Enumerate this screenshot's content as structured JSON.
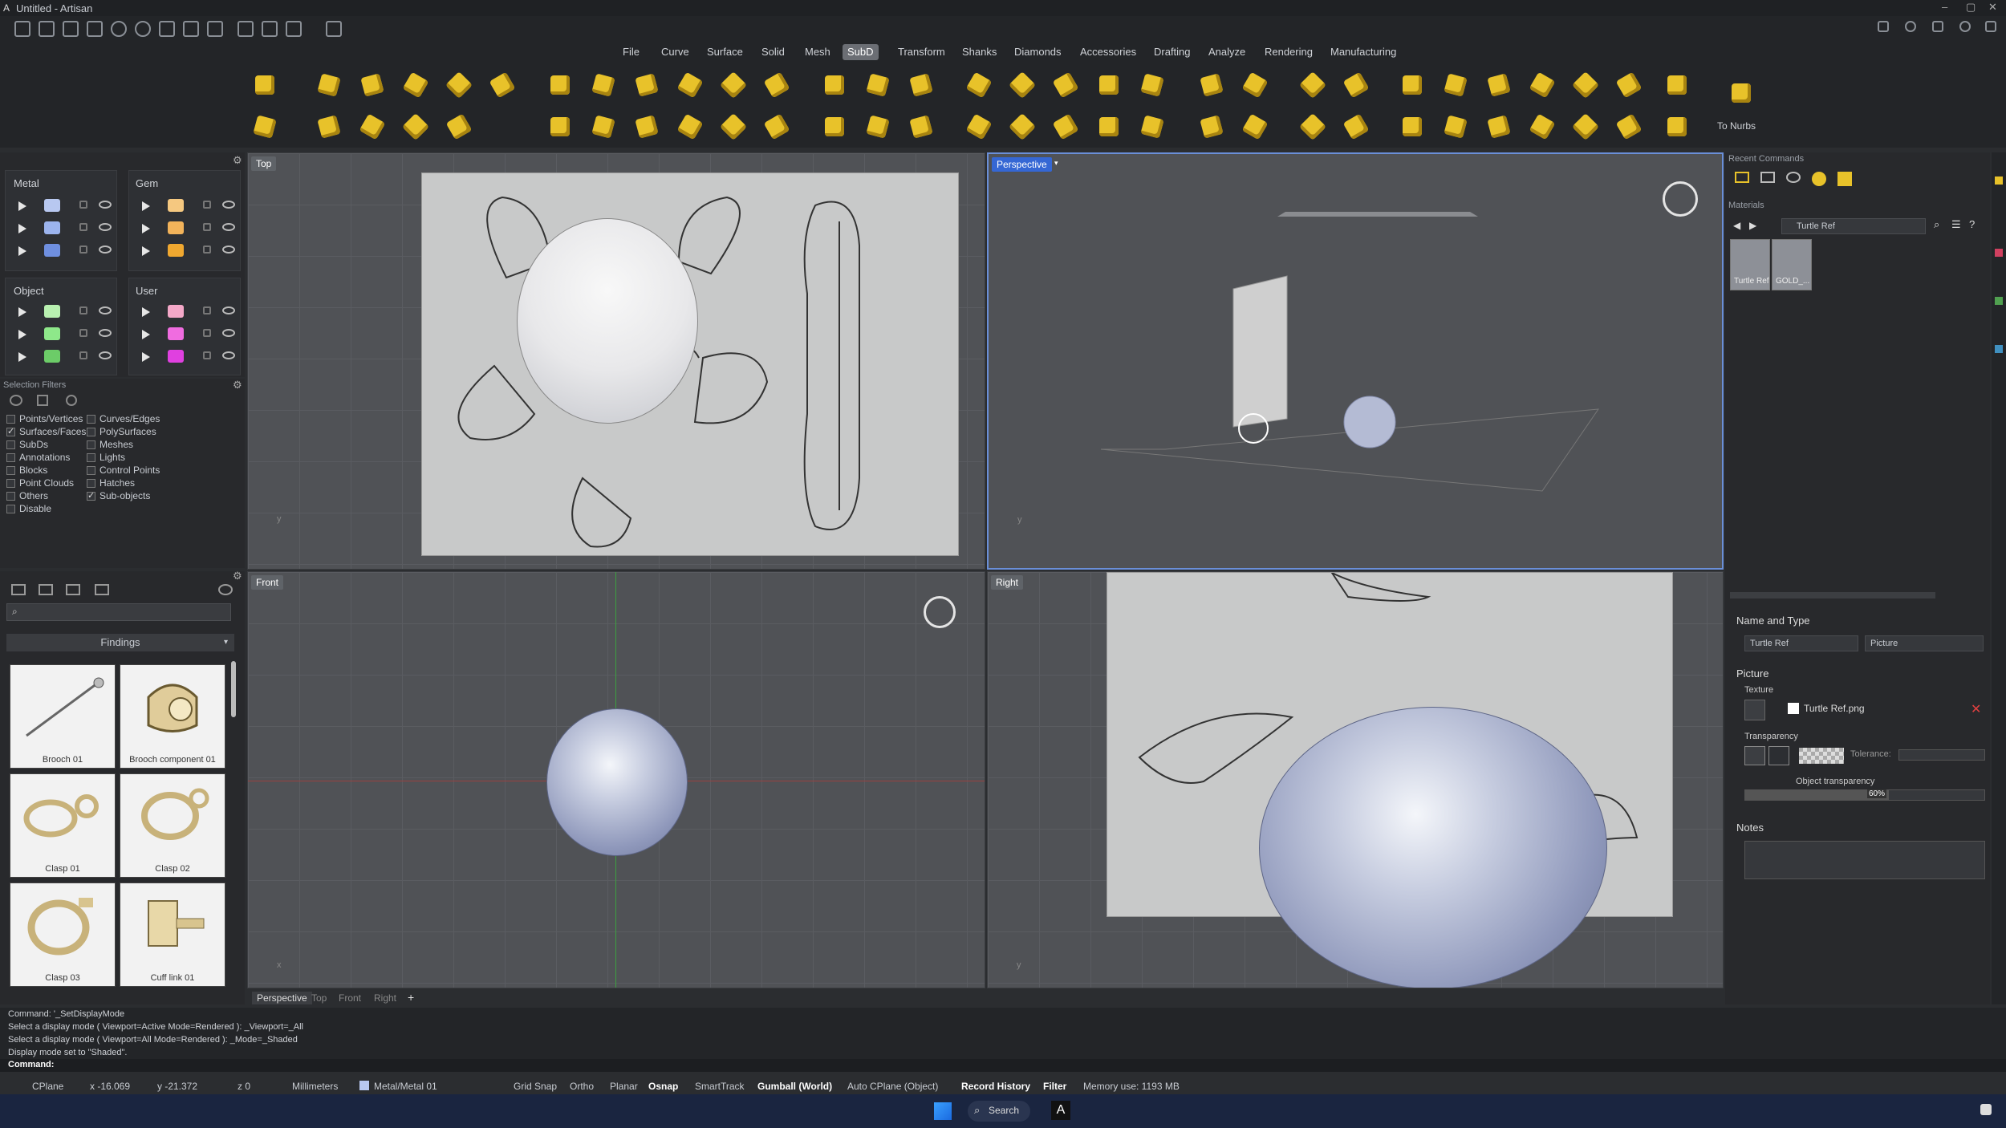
{
  "window": {
    "title": "Untitled - Artisan"
  },
  "menus": [
    "File",
    "Curve",
    "Surface",
    "Solid",
    "Mesh",
    "SubD",
    "Transform",
    "Shanks",
    "Diamonds",
    "Accessories",
    "Drafting",
    "Analyze",
    "Rendering",
    "Manufacturing"
  ],
  "active_menu": "SubD",
  "ribbon": {
    "to_nurbs": "To Nurbs"
  },
  "layers": {
    "metal": "Metal",
    "gem": "Gem",
    "object": "Object",
    "user": "User",
    "metal_colors": [
      "#b8c8f0",
      "#9cb4ee",
      "#6f8fe0"
    ],
    "gem_colors": [
      "#f5c880",
      "#f2b35a",
      "#f0a830"
    ],
    "object_colors": [
      "#b8f0b0",
      "#8ee88a",
      "#6ccc68"
    ],
    "user_colors": [
      "#f4a8c8",
      "#f06ce0",
      "#e040e0"
    ]
  },
  "selection_filters": {
    "title": "Selection Filters",
    "left": [
      {
        "label": "Points/Vertices",
        "on": false
      },
      {
        "label": "Surfaces/Faces",
        "on": true
      },
      {
        "label": "SubDs",
        "on": false
      },
      {
        "label": "Annotations",
        "on": false
      },
      {
        "label": "Blocks",
        "on": false
      },
      {
        "label": "Point Clouds",
        "on": false
      },
      {
        "label": "Others",
        "on": false
      },
      {
        "label": "Disable",
        "on": false
      }
    ],
    "right": [
      {
        "label": "Curves/Edges",
        "on": false
      },
      {
        "label": "PolySurfaces",
        "on": false
      },
      {
        "label": "Meshes",
        "on": false
      },
      {
        "label": "Lights",
        "on": false
      },
      {
        "label": "Control Points",
        "on": false
      },
      {
        "label": "Hatches",
        "on": false
      },
      {
        "label": "Sub-objects",
        "on": true
      }
    ]
  },
  "library": {
    "category": "Findings",
    "search_placeholder": "",
    "items": [
      "Brooch 01",
      "Brooch component 01",
      "Clasp 01",
      "Clasp 02",
      "Clasp 03",
      "Cuff link 01"
    ]
  },
  "viewports": {
    "top": "Top",
    "perspective": "Perspective",
    "front": "Front",
    "right": "Right"
  },
  "viewport_tabs": [
    "Perspective",
    "Top",
    "Front",
    "Right",
    "+"
  ],
  "command_history": [
    "Command: '_SetDisplayMode",
    "Select a display mode ( Viewport=Active  Mode=Rendered ): _Viewport=_All",
    "Select a display mode ( Viewport=All  Mode=Rendered ): _Mode=_Shaded",
    "Display mode set to \"Shaded\"."
  ],
  "command_prompt": "Command:",
  "statusbar": {
    "cplane": "CPlane",
    "x": "x -16.069",
    "y": "y -21.372",
    "z": "z 0",
    "units": "Millimeters",
    "layer": "Metal/Metal 01",
    "toggles": [
      {
        "label": "Grid Snap",
        "on": false
      },
      {
        "label": "Ortho",
        "on": false
      },
      {
        "label": "Planar",
        "on": false
      },
      {
        "label": "Osnap",
        "on": true
      },
      {
        "label": "SmartTrack",
        "on": false
      },
      {
        "label": "Gumball (World)",
        "on": true
      },
      {
        "label": "Auto CPlane (Object)",
        "on": false
      },
      {
        "label": "Record History",
        "on": true
      },
      {
        "label": "Filter",
        "on": true
      }
    ],
    "memory": "Memory use: 1193 MB"
  },
  "right_panel": {
    "recent_commands": "Recent Commands",
    "materials": "Materials",
    "material_path": "Turtle Ref",
    "material_items": [
      "Turtle Ref",
      "GOLD_..."
    ],
    "name_and_type": "Name and Type",
    "name_value": "Turtle Ref",
    "type_value": "Picture",
    "picture": "Picture",
    "texture": "Texture",
    "texture_file": "Turtle Ref.png",
    "transparency": "Transparency",
    "tolerance": "Tolerance:",
    "object_transparency": "Object transparency",
    "object_transparency_value": "60%",
    "notes": "Notes"
  },
  "taskbar": {
    "search": "Search"
  }
}
